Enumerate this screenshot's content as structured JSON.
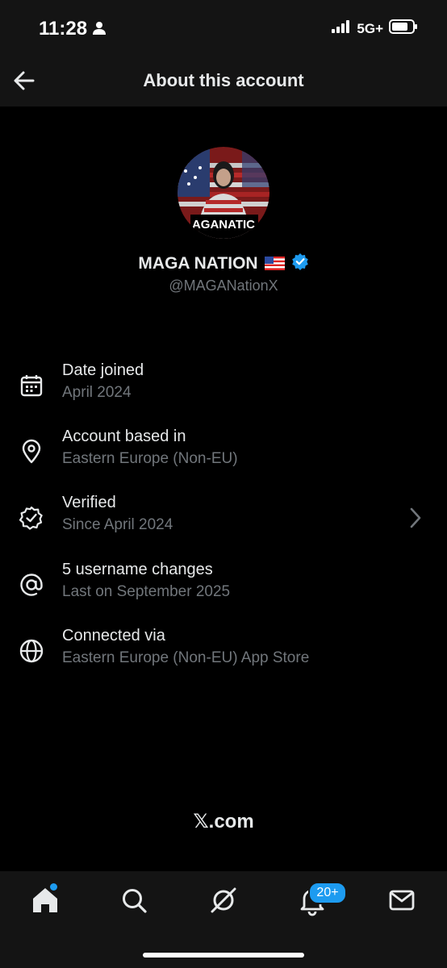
{
  "status_bar": {
    "time": "11:28",
    "network": "5G+"
  },
  "header": {
    "title": "About this account"
  },
  "profile": {
    "name": "MAGA NATION",
    "flag_emoji": "🇺🇸",
    "handle": "@MAGANationX",
    "avatar_text": "AGANATIC",
    "verified_color": "#1d9bf0"
  },
  "info_rows": [
    {
      "icon": "calendar-icon",
      "title": "Date joined",
      "subtitle": "April 2024"
    },
    {
      "icon": "location-pin-icon",
      "title": "Account based in",
      "subtitle": "Eastern Europe (Non-EU)"
    },
    {
      "icon": "verified-badge-icon",
      "title": "Verified",
      "subtitle": "Since April 2024"
    },
    {
      "icon": "at-sign-icon",
      "title": "5 username changes",
      "subtitle": "Last on September 2025"
    },
    {
      "icon": "globe-icon",
      "title": "Connected via",
      "subtitle": "Eastern Europe (Non-EU) App Store"
    }
  ],
  "footer": {
    "brand": "𝕏.com"
  },
  "tab_bar": {
    "tabs": [
      "home-icon",
      "search-icon",
      "grok-icon",
      "notifications-icon",
      "messages-icon"
    ],
    "notification_badge": "20+"
  },
  "colors": {
    "accent": "#1d9bf0",
    "background": "#000000",
    "bar": "#141414",
    "muted": "#71767b"
  }
}
